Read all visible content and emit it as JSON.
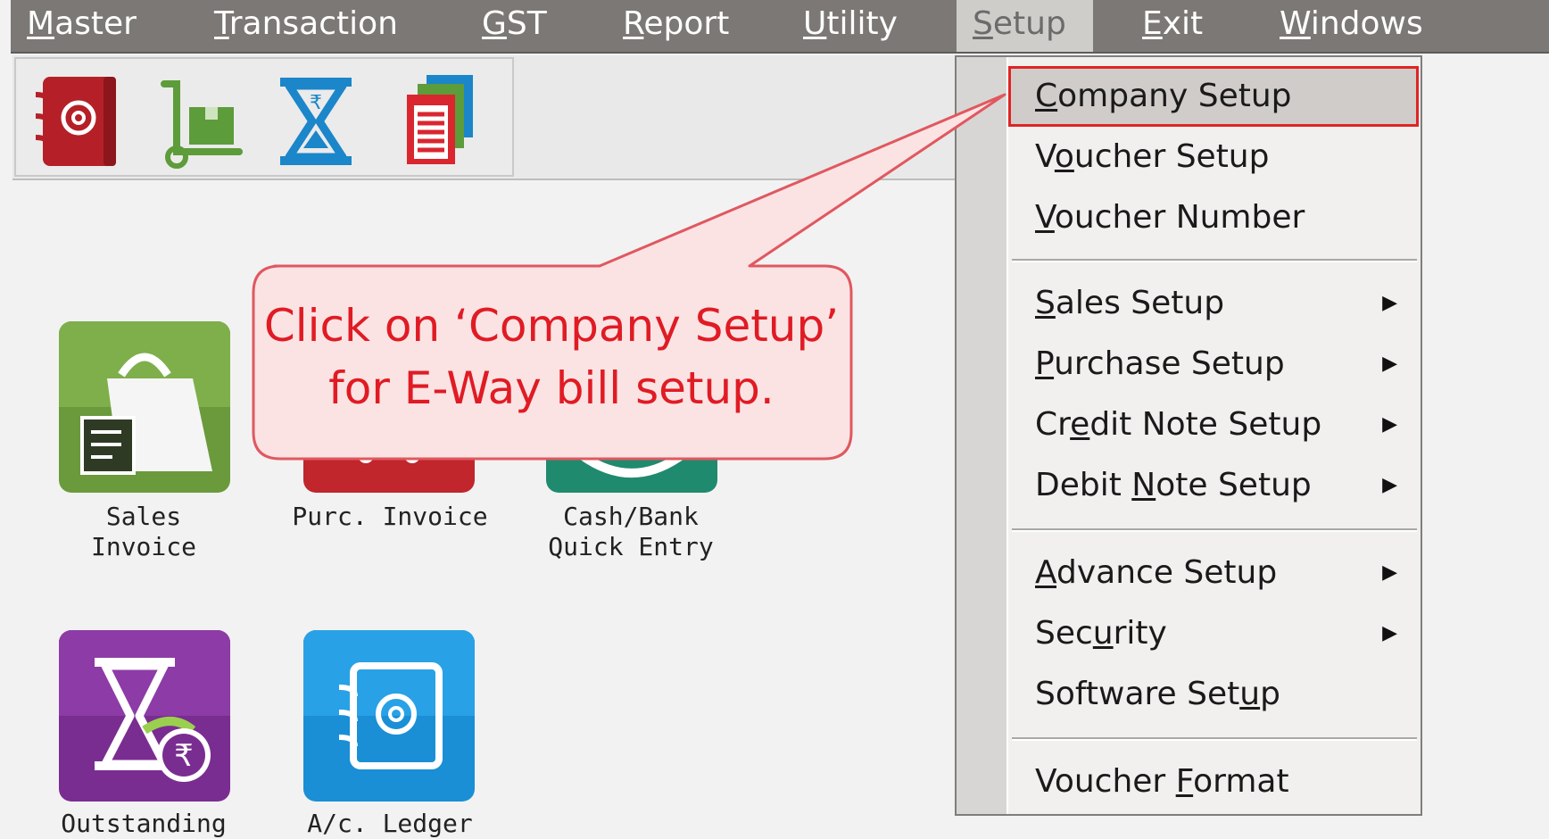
{
  "menubar": {
    "items": [
      {
        "pre": "",
        "key": "M",
        "post": "aster"
      },
      {
        "pre": "",
        "key": "T",
        "post": "ransaction"
      },
      {
        "pre": "",
        "key": "G",
        "post": "ST"
      },
      {
        "pre": "",
        "key": "R",
        "post": "eport"
      },
      {
        "pre": "",
        "key": "U",
        "post": "tility"
      },
      {
        "pre": "",
        "key": "S",
        "post": "etup"
      },
      {
        "pre": "",
        "key": "E",
        "post": "xit"
      },
      {
        "pre": "",
        "key": "W",
        "post": "indows"
      }
    ],
    "active_index": 5
  },
  "toolbar": {
    "icons": [
      "address-book-icon",
      "hand-truck-icon",
      "hourglass-rupee-icon",
      "documents-icon"
    ]
  },
  "tiles": [
    {
      "name": "sales-invoice",
      "label_line1": "Sales",
      "label_line2": "Invoice",
      "color": "#6a9a3c",
      "icon": "shopping-bag-icon"
    },
    {
      "name": "purc-invoice",
      "label_line1": "Purc. Invoice",
      "label_line2": "",
      "color": "#c0262c",
      "icon": "cart-icon"
    },
    {
      "name": "cash-bank-quick-entry",
      "label_line1": "Cash/Bank",
      "label_line2": "Quick Entry",
      "color": "#1f8a6e",
      "icon": "cash-icon"
    },
    {
      "name": "outstanding",
      "label_line1": "Outstanding",
      "label_line2": "",
      "color": "#7a2d91",
      "icon": "hourglass-rupee-icon"
    },
    {
      "name": "ac-ledger",
      "label_line1": "A/c. Ledger",
      "label_line2": "",
      "color": "#1a8fd6",
      "icon": "address-book-icon"
    }
  ],
  "dropdown": {
    "items": [
      {
        "pre": "",
        "key": "C",
        "post": "ompany Setup",
        "submenu": false
      },
      {
        "pre": "V",
        "key": "o",
        "post": "ucher Setup",
        "submenu": false
      },
      {
        "pre": "",
        "key": "V",
        "post": "oucher Number",
        "submenu": false
      },
      {
        "pre": "",
        "key": "S",
        "post": "ales Setup",
        "submenu": true
      },
      {
        "pre": "",
        "key": "P",
        "post": "urchase Setup",
        "submenu": true
      },
      {
        "pre": "Cr",
        "key": "e",
        "post": "dit Note Setup",
        "submenu": true
      },
      {
        "pre": "Debit ",
        "key": "N",
        "post": "ote Setup",
        "submenu": true
      },
      {
        "pre": "",
        "key": "A",
        "post": "dvance Setup",
        "submenu": true
      },
      {
        "pre": "Sec",
        "key": "u",
        "post": "rity",
        "submenu": true
      },
      {
        "pre": "Software Set",
        "key": "u",
        "post": "p",
        "submenu": false
      },
      {
        "pre": "Voucher ",
        "key": "F",
        "post": "ormat",
        "submenu": false
      }
    ],
    "highlighted_index": 0,
    "submenu_arrow": "▶"
  },
  "callout": {
    "line1": "Click on ‘Company Setup’",
    "line2": "for E-Way bill setup.",
    "text_color": "#e01b24",
    "fill_color": "#fbe3e4",
    "border_color": "#e0585f"
  }
}
